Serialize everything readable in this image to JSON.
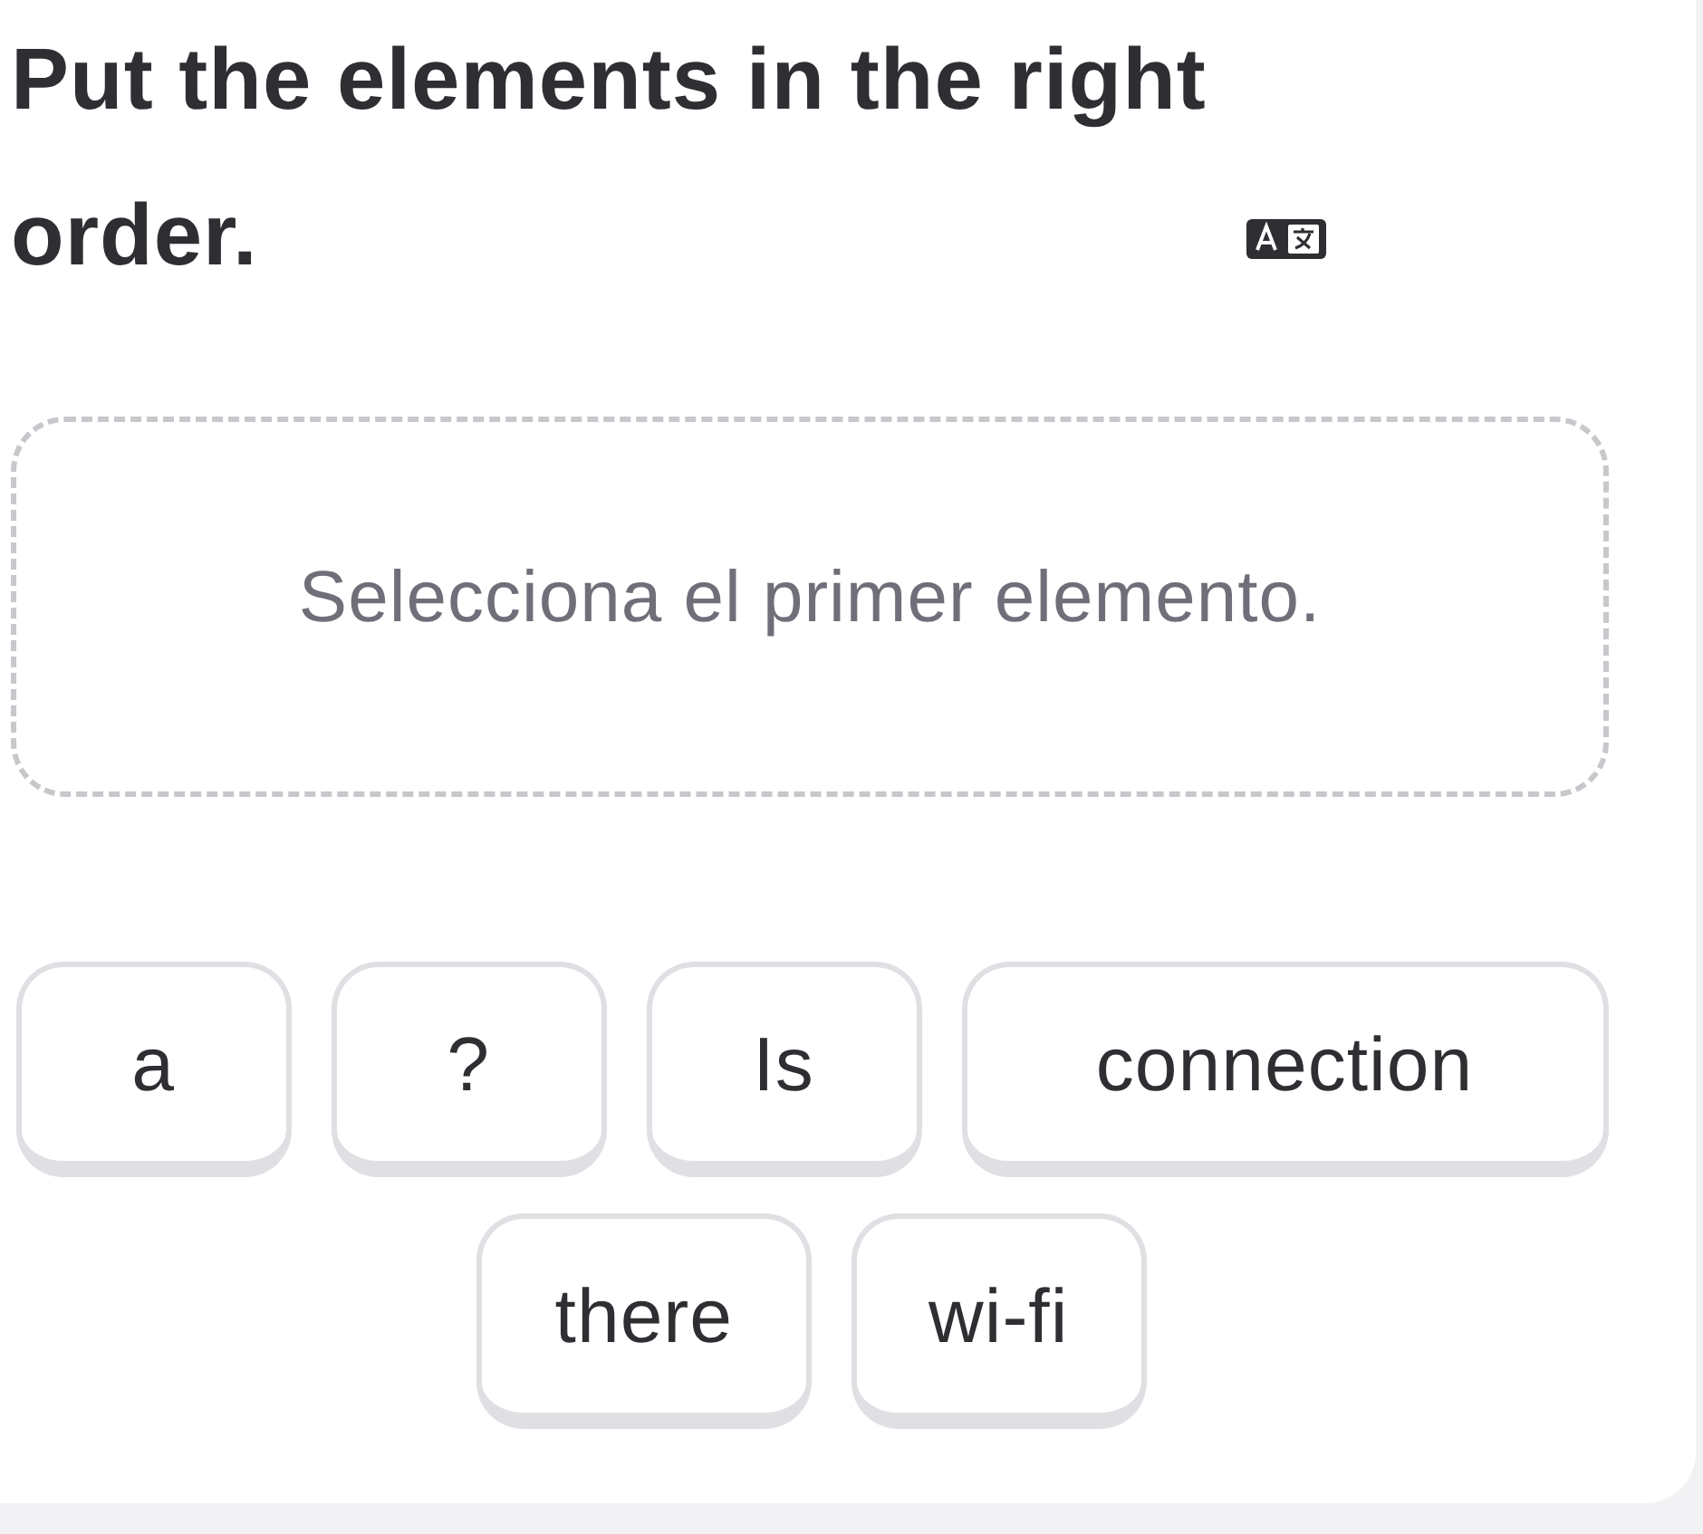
{
  "title": "Put the elements in the right order.",
  "answer_area": {
    "placeholder": "Selecciona el primer elemento."
  },
  "word_bank": [
    {
      "label": "a"
    },
    {
      "label": "?"
    },
    {
      "label": "Is"
    },
    {
      "label": "connection"
    },
    {
      "label": "there"
    },
    {
      "label": "wi-fi"
    }
  ]
}
